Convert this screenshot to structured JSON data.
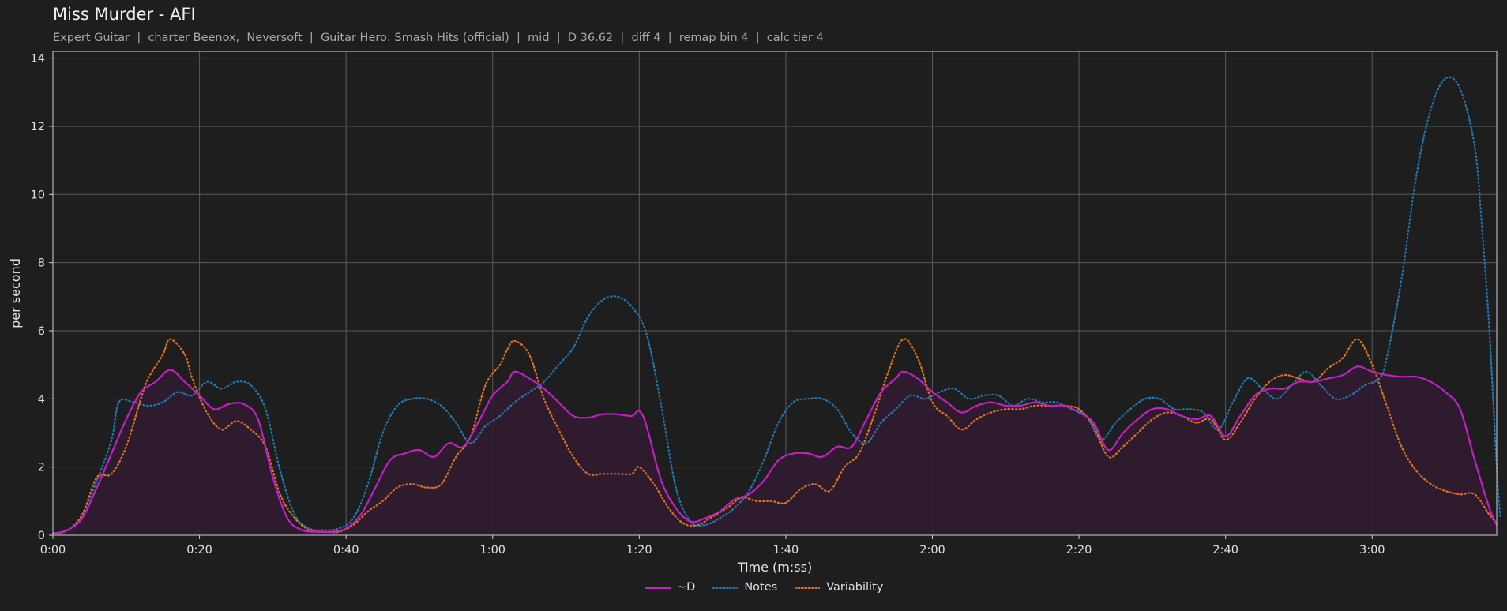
{
  "title": "Miss Murder - AFI",
  "subtitle": "Expert Guitar  |  charter Beenox,  Neversoft  |  Guitar Hero: Smash Hits (official)  |  mid  |  D 36.62  |  diff 4  |  remap bin 4  |  calc tier 4",
  "chart_data": {
    "type": "line",
    "xlabel": "Time (m:ss)",
    "ylabel": "per second",
    "xlim": [
      0,
      197
    ],
    "ylim": [
      0,
      14.2
    ],
    "x_ticks": [
      0,
      20,
      40,
      60,
      80,
      100,
      120,
      140,
      160,
      180
    ],
    "x_tick_labels": [
      "0:00",
      "0:20",
      "0:40",
      "1:00",
      "1:20",
      "1:40",
      "2:00",
      "2:20",
      "2:40",
      "3:00"
    ],
    "y_ticks": [
      0,
      2,
      4,
      6,
      8,
      10,
      12,
      14
    ],
    "y_tick_labels": [
      "0",
      "2",
      "4",
      "6",
      "8",
      "10",
      "12",
      "14"
    ],
    "grid": true,
    "legend_position": "bottom-center",
    "colors": {
      "d": "#c21fc4",
      "notes": "#1f77b4",
      "variability": "#e0701c",
      "fill": "#2f1c2f"
    },
    "series": [
      {
        "name": "~D",
        "style": "solid",
        "fill": true,
        "points": [
          [
            0,
            0.05
          ],
          [
            2,
            0.15
          ],
          [
            4,
            0.5
          ],
          [
            6,
            1.4
          ],
          [
            8,
            2.4
          ],
          [
            10,
            3.4
          ],
          [
            12,
            4.2
          ],
          [
            14,
            4.5
          ],
          [
            16,
            4.85
          ],
          [
            18,
            4.5
          ],
          [
            20,
            4.1
          ],
          [
            22,
            3.7
          ],
          [
            24,
            3.85
          ],
          [
            26,
            3.85
          ],
          [
            28,
            3.4
          ],
          [
            30,
            1.7
          ],
          [
            32,
            0.5
          ],
          [
            34,
            0.15
          ],
          [
            36,
            0.1
          ],
          [
            38,
            0.1
          ],
          [
            40,
            0.2
          ],
          [
            42,
            0.6
          ],
          [
            44,
            1.4
          ],
          [
            46,
            2.2
          ],
          [
            48,
            2.4
          ],
          [
            50,
            2.5
          ],
          [
            52,
            2.3
          ],
          [
            54,
            2.7
          ],
          [
            56,
            2.6
          ],
          [
            58,
            3.3
          ],
          [
            60,
            4.1
          ],
          [
            62,
            4.5
          ],
          [
            63,
            4.8
          ],
          [
            65,
            4.6
          ],
          [
            67,
            4.3
          ],
          [
            69,
            3.9
          ],
          [
            71,
            3.5
          ],
          [
            73,
            3.45
          ],
          [
            75,
            3.55
          ],
          [
            77,
            3.55
          ],
          [
            79,
            3.5
          ],
          [
            80,
            3.65
          ],
          [
            81,
            3.2
          ],
          [
            83,
            1.6
          ],
          [
            85,
            0.8
          ],
          [
            87,
            0.4
          ],
          [
            89,
            0.5
          ],
          [
            91,
            0.7
          ],
          [
            93,
            1.05
          ],
          [
            95,
            1.2
          ],
          [
            97,
            1.6
          ],
          [
            99,
            2.2
          ],
          [
            101,
            2.4
          ],
          [
            103,
            2.4
          ],
          [
            105,
            2.3
          ],
          [
            107,
            2.6
          ],
          [
            109,
            2.6
          ],
          [
            111,
            3.4
          ],
          [
            113,
            4.2
          ],
          [
            115,
            4.6
          ],
          [
            116,
            4.8
          ],
          [
            118,
            4.6
          ],
          [
            120,
            4.2
          ],
          [
            122,
            3.9
          ],
          [
            124,
            3.6
          ],
          [
            126,
            3.8
          ],
          [
            128,
            3.9
          ],
          [
            130,
            3.8
          ],
          [
            132,
            3.8
          ],
          [
            134,
            3.9
          ],
          [
            136,
            3.8
          ],
          [
            138,
            3.8
          ],
          [
            140,
            3.6
          ],
          [
            142,
            3.3
          ],
          [
            144,
            2.5
          ],
          [
            146,
            3.0
          ],
          [
            148,
            3.4
          ],
          [
            150,
            3.7
          ],
          [
            152,
            3.7
          ],
          [
            154,
            3.5
          ],
          [
            156,
            3.4
          ],
          [
            158,
            3.5
          ],
          [
            160,
            2.9
          ],
          [
            162,
            3.5
          ],
          [
            164,
            4.1
          ],
          [
            166,
            4.3
          ],
          [
            168,
            4.3
          ],
          [
            170,
            4.5
          ],
          [
            172,
            4.5
          ],
          [
            174,
            4.6
          ],
          [
            176,
            4.7
          ],
          [
            178,
            4.95
          ],
          [
            180,
            4.8
          ],
          [
            182,
            4.7
          ],
          [
            184,
            4.65
          ],
          [
            186,
            4.65
          ],
          [
            188,
            4.5
          ],
          [
            190,
            4.2
          ],
          [
            192,
            3.7
          ],
          [
            194,
            2.2
          ],
          [
            196,
            0.8
          ],
          [
            197,
            0.3
          ]
        ]
      },
      {
        "name": "Notes",
        "style": "dotted",
        "points": [
          [
            0,
            0.05
          ],
          [
            2,
            0.15
          ],
          [
            4,
            0.6
          ],
          [
            6,
            1.6
          ],
          [
            8,
            2.8
          ],
          [
            9,
            3.9
          ],
          [
            11,
            3.9
          ],
          [
            13,
            3.8
          ],
          [
            15,
            3.9
          ],
          [
            17,
            4.2
          ],
          [
            19,
            4.1
          ],
          [
            21,
            4.5
          ],
          [
            23,
            4.3
          ],
          [
            25,
            4.5
          ],
          [
            27,
            4.4
          ],
          [
            29,
            3.7
          ],
          [
            31,
            1.9
          ],
          [
            33,
            0.6
          ],
          [
            35,
            0.2
          ],
          [
            37,
            0.15
          ],
          [
            39,
            0.2
          ],
          [
            41,
            0.5
          ],
          [
            43,
            1.5
          ],
          [
            45,
            3.0
          ],
          [
            47,
            3.8
          ],
          [
            49,
            4.0
          ],
          [
            51,
            4.0
          ],
          [
            53,
            3.8
          ],
          [
            55,
            3.3
          ],
          [
            57,
            2.7
          ],
          [
            59,
            3.2
          ],
          [
            61,
            3.5
          ],
          [
            63,
            3.9
          ],
          [
            65,
            4.2
          ],
          [
            67,
            4.5
          ],
          [
            69,
            5.0
          ],
          [
            71,
            5.5
          ],
          [
            73,
            6.4
          ],
          [
            75,
            6.9
          ],
          [
            77,
            7.0
          ],
          [
            79,
            6.7
          ],
          [
            81,
            5.9
          ],
          [
            83,
            3.8
          ],
          [
            85,
            1.4
          ],
          [
            87,
            0.4
          ],
          [
            89,
            0.3
          ],
          [
            91,
            0.5
          ],
          [
            93,
            0.8
          ],
          [
            95,
            1.3
          ],
          [
            97,
            2.2
          ],
          [
            99,
            3.3
          ],
          [
            101,
            3.9
          ],
          [
            103,
            4.0
          ],
          [
            105,
            4.0
          ],
          [
            107,
            3.7
          ],
          [
            109,
            3.0
          ],
          [
            111,
            2.7
          ],
          [
            113,
            3.3
          ],
          [
            115,
            3.7
          ],
          [
            117,
            4.1
          ],
          [
            119,
            4.0
          ],
          [
            121,
            4.2
          ],
          [
            123,
            4.3
          ],
          [
            125,
            4.0
          ],
          [
            127,
            4.1
          ],
          [
            129,
            4.1
          ],
          [
            131,
            3.8
          ],
          [
            133,
            4.0
          ],
          [
            135,
            3.9
          ],
          [
            137,
            3.9
          ],
          [
            139,
            3.7
          ],
          [
            141,
            3.5
          ],
          [
            143,
            2.8
          ],
          [
            145,
            3.3
          ],
          [
            147,
            3.7
          ],
          [
            149,
            4.0
          ],
          [
            151,
            4.0
          ],
          [
            153,
            3.7
          ],
          [
            155,
            3.7
          ],
          [
            157,
            3.6
          ],
          [
            159,
            3.1
          ],
          [
            161,
            3.9
          ],
          [
            163,
            4.6
          ],
          [
            165,
            4.3
          ],
          [
            167,
            4.0
          ],
          [
            169,
            4.4
          ],
          [
            171,
            4.8
          ],
          [
            173,
            4.4
          ],
          [
            175,
            4.0
          ],
          [
            177,
            4.1
          ],
          [
            179,
            4.4
          ],
          [
            181,
            4.6
          ],
          [
            182,
            5.2
          ],
          [
            184,
            7.5
          ],
          [
            186,
            10.5
          ],
          [
            188,
            12.5
          ],
          [
            190,
            13.4
          ],
          [
            192,
            13.1
          ],
          [
            194,
            11.4
          ],
          [
            195,
            9.0
          ],
          [
            196,
            6.0
          ],
          [
            197,
            2.0
          ],
          [
            197.5,
            0.5
          ]
        ]
      },
      {
        "name": "Variability",
        "style": "dotted",
        "points": [
          [
            0,
            0.05
          ],
          [
            2,
            0.15
          ],
          [
            4,
            0.6
          ],
          [
            6,
            1.7
          ],
          [
            8,
            1.8
          ],
          [
            10,
            2.6
          ],
          [
            12,
            4.0
          ],
          [
            13,
            4.6
          ],
          [
            15,
            5.3
          ],
          [
            16,
            5.75
          ],
          [
            18,
            5.3
          ],
          [
            19,
            4.6
          ],
          [
            21,
            3.6
          ],
          [
            23,
            3.1
          ],
          [
            25,
            3.35
          ],
          [
            27,
            3.1
          ],
          [
            29,
            2.6
          ],
          [
            31,
            1.2
          ],
          [
            33,
            0.5
          ],
          [
            35,
            0.15
          ],
          [
            37,
            0.1
          ],
          [
            39,
            0.1
          ],
          [
            41,
            0.3
          ],
          [
            43,
            0.7
          ],
          [
            45,
            1.0
          ],
          [
            47,
            1.4
          ],
          [
            49,
            1.5
          ],
          [
            51,
            1.4
          ],
          [
            53,
            1.5
          ],
          [
            55,
            2.3
          ],
          [
            57,
            2.9
          ],
          [
            59,
            4.4
          ],
          [
            61,
            5.0
          ],
          [
            62,
            5.45
          ],
          [
            63,
            5.7
          ],
          [
            65,
            5.3
          ],
          [
            67,
            4.0
          ],
          [
            69,
            3.1
          ],
          [
            71,
            2.3
          ],
          [
            73,
            1.8
          ],
          [
            75,
            1.8
          ],
          [
            77,
            1.8
          ],
          [
            79,
            1.8
          ],
          [
            80,
            2.0
          ],
          [
            82,
            1.5
          ],
          [
            84,
            0.8
          ],
          [
            86,
            0.35
          ],
          [
            88,
            0.3
          ],
          [
            90,
            0.55
          ],
          [
            92,
            0.8
          ],
          [
            94,
            1.1
          ],
          [
            96,
            1.0
          ],
          [
            98,
            1.0
          ],
          [
            100,
            0.95
          ],
          [
            102,
            1.35
          ],
          [
            104,
            1.5
          ],
          [
            106,
            1.3
          ],
          [
            108,
            2.0
          ],
          [
            110,
            2.4
          ],
          [
            112,
            3.5
          ],
          [
            114,
            4.8
          ],
          [
            116,
            5.75
          ],
          [
            118,
            5.2
          ],
          [
            120,
            3.9
          ],
          [
            122,
            3.5
          ],
          [
            124,
            3.1
          ],
          [
            126,
            3.4
          ],
          [
            128,
            3.6
          ],
          [
            130,
            3.7
          ],
          [
            132,
            3.7
          ],
          [
            134,
            3.8
          ],
          [
            136,
            3.8
          ],
          [
            138,
            3.8
          ],
          [
            140,
            3.7
          ],
          [
            142,
            3.2
          ],
          [
            144,
            2.3
          ],
          [
            146,
            2.6
          ],
          [
            148,
            3.0
          ],
          [
            150,
            3.4
          ],
          [
            152,
            3.6
          ],
          [
            154,
            3.5
          ],
          [
            156,
            3.3
          ],
          [
            158,
            3.4
          ],
          [
            160,
            2.8
          ],
          [
            162,
            3.3
          ],
          [
            164,
            4.0
          ],
          [
            166,
            4.5
          ],
          [
            168,
            4.7
          ],
          [
            170,
            4.6
          ],
          [
            172,
            4.5
          ],
          [
            174,
            4.9
          ],
          [
            176,
            5.2
          ],
          [
            178,
            5.75
          ],
          [
            180,
            5.0
          ],
          [
            182,
            3.8
          ],
          [
            184,
            2.6
          ],
          [
            186,
            1.9
          ],
          [
            188,
            1.5
          ],
          [
            190,
            1.3
          ],
          [
            192,
            1.2
          ],
          [
            194,
            1.2
          ],
          [
            196,
            0.6
          ],
          [
            197,
            0.35
          ]
        ]
      }
    ]
  }
}
